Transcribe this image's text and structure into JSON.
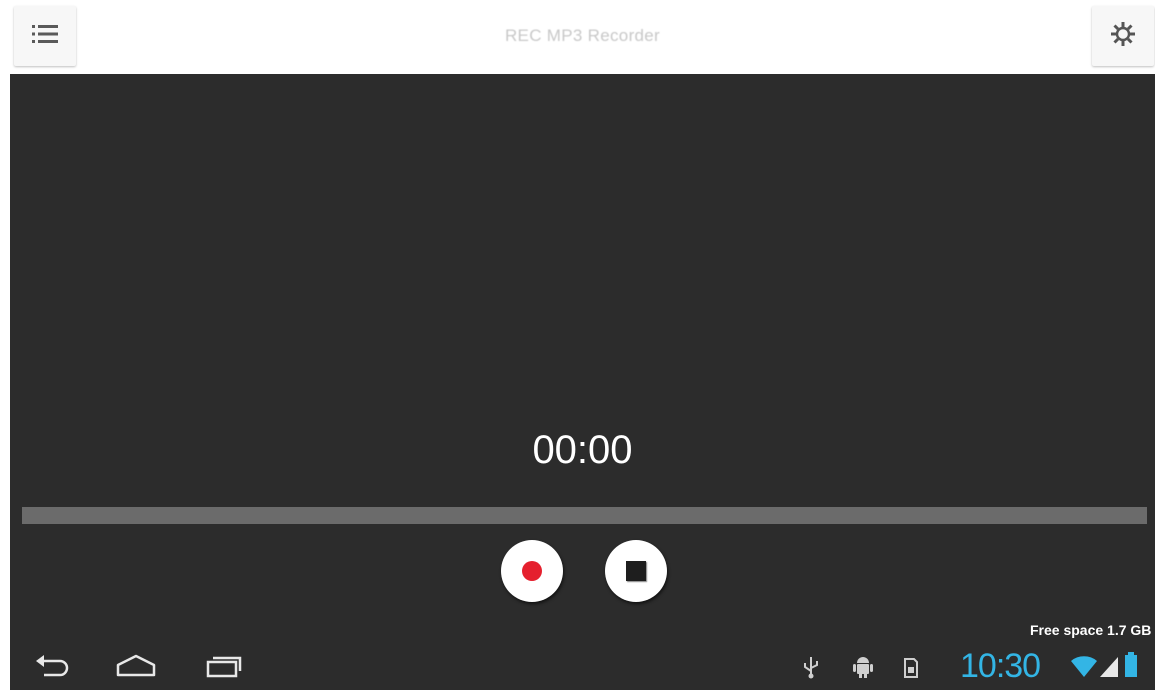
{
  "app": {
    "title": "REC MP3 Recorder"
  },
  "topbar": {
    "menu_icon": "list-icon",
    "settings_icon": "gear-icon"
  },
  "recorder": {
    "timer": "00:00",
    "progress_fraction": 0,
    "record_icon": "record-icon",
    "stop_icon": "stop-icon",
    "free_space": "Free space 1.7 GB"
  },
  "system_bar": {
    "clock": "10:30",
    "nav_icons": [
      "back-icon",
      "home-icon",
      "recent-apps-icon"
    ],
    "status_icons": [
      "usb-icon",
      "android-debug-icon",
      "sd-card-icon",
      "wifi-icon",
      "signal-icon",
      "battery-icon"
    ]
  },
  "colors": {
    "background": "#2c2c2c",
    "accent_clock": "#33b5e5",
    "record_red": "#e5202e",
    "progress_track": "#6b6b6b"
  }
}
